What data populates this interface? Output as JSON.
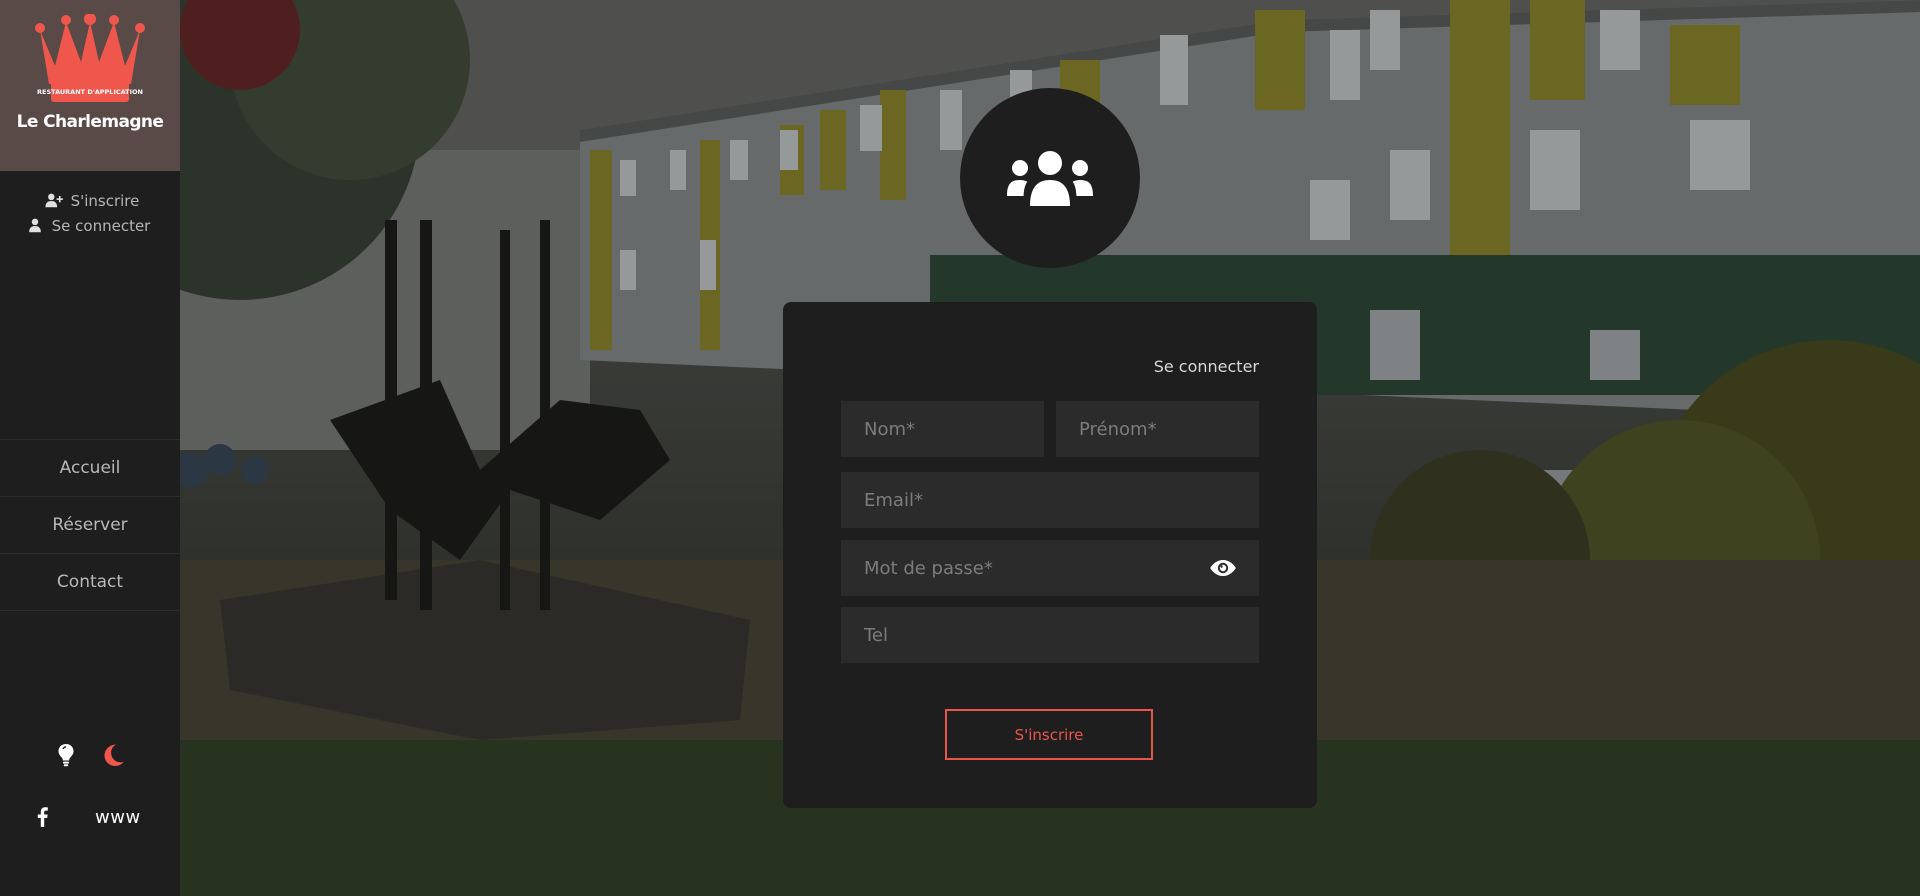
{
  "brand": {
    "name": "Le Charlemagne",
    "logo_text": "RESTAURANT D'APPLICATION",
    "logo_color": "#f0574c"
  },
  "auth_links": {
    "register": "S'inscrire",
    "login": "Se connecter"
  },
  "nav": {
    "items": [
      {
        "label": "Accueil"
      },
      {
        "label": "Réserver"
      },
      {
        "label": "Contact"
      }
    ]
  },
  "theme": {
    "light_icon": "lightbulb-icon",
    "dark_icon": "moon-icon",
    "accent": "#f0574c"
  },
  "socials": {
    "facebook_icon": "facebook-icon",
    "website_label": "www"
  },
  "form": {
    "login_link": "Se connecter",
    "nom_placeholder": "Nom*",
    "prenom_placeholder": "Prénom*",
    "email_placeholder": "Email*",
    "password_placeholder": "Mot de passe*",
    "tel_placeholder": "Tel",
    "submit_label": "S'inscrire",
    "avatar_icon": "users-icon",
    "password_toggle_icon": "eye-icon"
  }
}
